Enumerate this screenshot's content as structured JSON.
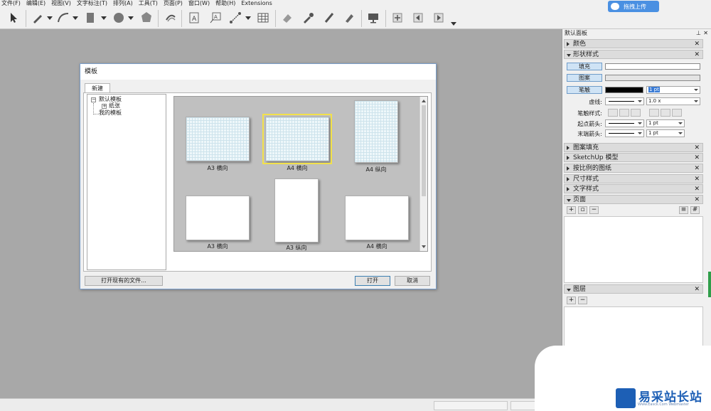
{
  "menu": [
    "文件(F)",
    "编辑(E)",
    "视图(V)",
    "文字标注(T)",
    "排列(A)",
    "工具(T)",
    "页面(P)",
    "窗口(W)",
    "帮助(H)",
    "Extensions"
  ],
  "toolbar_icons": [
    "select-arrow",
    "pencil",
    "arc",
    "rectangle",
    "circle",
    "polygon",
    "offset",
    "text",
    "label",
    "dimension",
    "table",
    "eraser",
    "eyedropper",
    "split",
    "join",
    "presentation",
    "add-page",
    "prev-page",
    "next-page"
  ],
  "cloud_button": "拖拽上传",
  "dialog": {
    "title": "模板",
    "tab": "新建",
    "tree": {
      "root": "默认模板",
      "child": "纸张",
      "sibling": "我的模板"
    },
    "templates": [
      {
        "label": "A3 横向",
        "style": "grid"
      },
      {
        "label": "A4 横向",
        "style": "grid",
        "selected": true
      },
      {
        "label": "A4 纵向",
        "style": "grid"
      },
      {
        "label": "A3 横向",
        "style": "plain"
      },
      {
        "label": "A3 纵向",
        "style": "plain"
      },
      {
        "label": "A4 横向",
        "style": "plain"
      }
    ],
    "open_existing": "打开现有的文件...",
    "open": "打开",
    "cancel": "取消"
  },
  "panel": {
    "title": "默认面板",
    "sections": {
      "color": "颜色",
      "shape_style": "形状样式",
      "pattern_fill": "图案填充",
      "sketchup_model": "SketchUp 模型",
      "scaled_drawing": "按比例的图纸",
      "dimension_style": "尺寸样式",
      "text_style": "文字样式",
      "pages": "页面",
      "layers": "图层"
    },
    "shape": {
      "fill": "填充",
      "pattern": "图案",
      "stroke": "笔触",
      "stroke_width": "1 pt",
      "dash_label": "虚线:",
      "dash_value": "1.0 x",
      "stroke_style_label": "笔触样式:",
      "start_arrow_label": "起点箭头:",
      "start_arrow_value": "1 pt",
      "end_arrow_label": "末端箭头:",
      "end_arrow_value": "1 pt"
    }
  },
  "watermark": {
    "text": "易采站长站",
    "sub": "Www.Easck.Com Webmaster"
  },
  "colors": {
    "accent": "#4a90e2",
    "selection": "#f2e14a",
    "canvas": "#a8a8a8"
  }
}
